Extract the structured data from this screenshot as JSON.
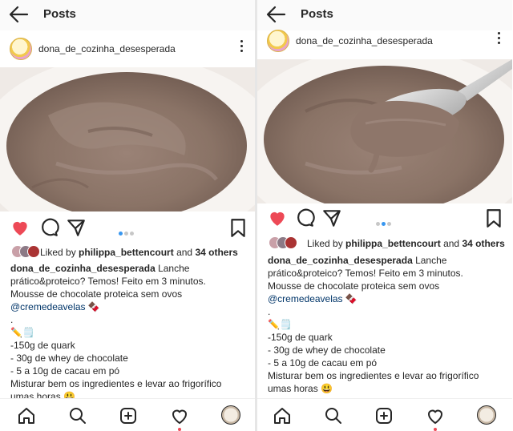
{
  "topbar": {
    "title": "Posts"
  },
  "post": {
    "username": "dona_de_cozinha_desesperada",
    "liked_by_prefix": "Liked by",
    "liked_by_user": "philippa_bettencourt",
    "liked_by_and": "and",
    "liked_by_others": "34 others",
    "carousel": {
      "count": 3,
      "active_left": 1,
      "active_right": 2
    },
    "caption": {
      "author": "dona_de_cozinha_desesperada",
      "line1_rest": " Lanche",
      "line2": "prático&proteico? Temos! Feito em 3 minutos.",
      "line3": "Mousse de chocolate proteica sem ovos",
      "mention": "@cremedeavelas",
      "emoji_chocolate": "🍫",
      "dot": ".",
      "emoji_pencil": "✏️🗒️",
      "ing1": "-150g de quark",
      "ing2": "- 30g de whey de chocolate",
      "ing3": "- 5 a 10g de cacau em pó",
      "method1": "Misturar bem os ingredientes e levar ao frigorífico",
      "method2": "umas horas",
      "emoji_smile": "😃"
    }
  },
  "icons": {
    "back": "arrow-left-icon",
    "more": "more-vertical-icon",
    "like": "heart-filled-icon",
    "comment": "comment-icon",
    "share": "send-icon",
    "save": "bookmark-icon",
    "home": "home-icon",
    "search": "search-icon",
    "new_post": "add-post-icon",
    "activity": "heart-outline-icon",
    "profile": "profile-avatar"
  },
  "colors": {
    "like_red": "#ed4956",
    "carousel_active": "#3897f0",
    "mention_blue": "#003569",
    "mousse": "#8a7366"
  }
}
